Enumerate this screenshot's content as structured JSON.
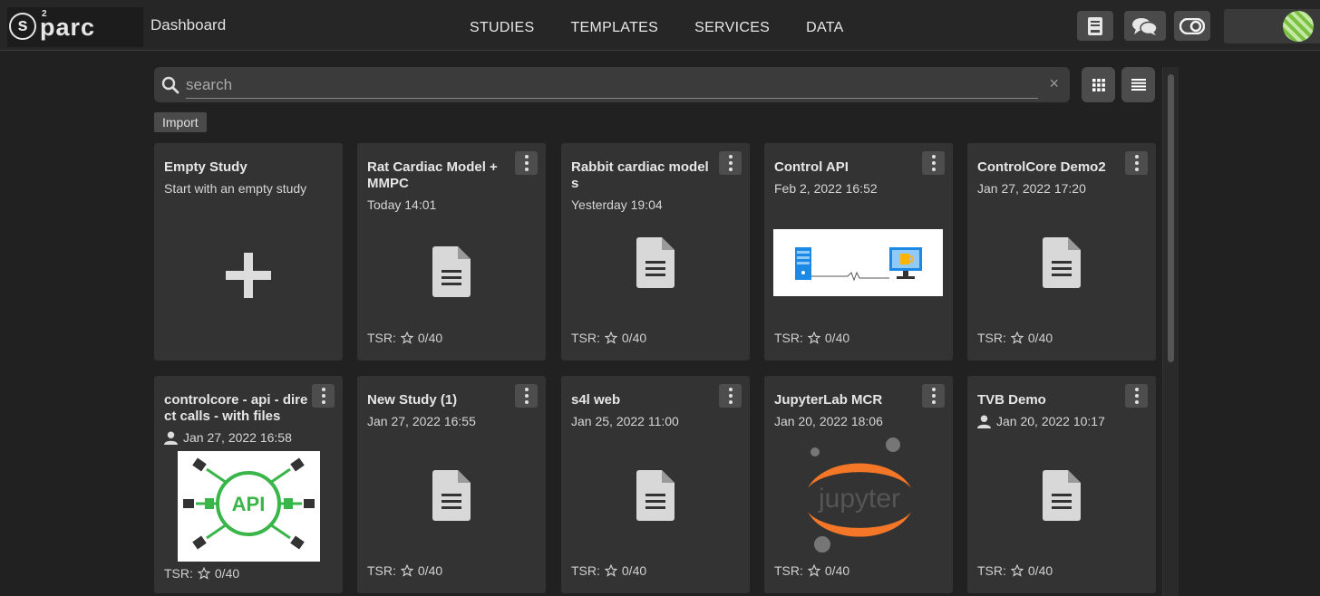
{
  "app": {
    "logo_text": "parc",
    "logo_sup": "2",
    "logo_letter": "s",
    "page_title": "Dashboard"
  },
  "nav": {
    "items": [
      {
        "label": "STUDIES"
      },
      {
        "label": "TEMPLATES"
      },
      {
        "label": "SERVICES"
      },
      {
        "label": "DATA"
      }
    ]
  },
  "toolbar": {
    "icons": [
      "manual-icon",
      "chat-icon",
      "theme-toggle-icon"
    ],
    "avatar": "user-avatar"
  },
  "search": {
    "placeholder": "search",
    "value": "",
    "clear": "×"
  },
  "view_modes": [
    "grid-view-icon",
    "list-view-icon"
  ],
  "import_label": "Import",
  "colors": {
    "background": "#212121",
    "card": "#333333",
    "accent_orange": "#f37726",
    "api_green": "#3ab54a"
  },
  "cards": [
    {
      "title": "Empty Study",
      "subtitle": "Start with an empty study",
      "type": "new"
    },
    {
      "title": "Rat Cardiac Model + MMPC",
      "date": "Today 14:01",
      "tsr": "TSR:",
      "tsr_value": "0/40",
      "thumb": "document-icon"
    },
    {
      "title": "Rabbit cardiac models",
      "date": "Yesterday 19:04",
      "tsr": "TSR:",
      "tsr_value": "0/40",
      "thumb": "document-icon"
    },
    {
      "title": "Control API",
      "date": "Feb 2, 2022 16:52",
      "tsr": "TSR:",
      "tsr_value": "0/40",
      "thumb": "server-to-monitor-image"
    },
    {
      "title": "ControlCore Demo2",
      "date": "Jan 27, 2022 17:20",
      "tsr": "TSR:",
      "tsr_value": "0/40",
      "thumb": "document-icon"
    },
    {
      "title": "controlcore - api - direct calls - with files",
      "date": "Jan 27, 2022 16:58",
      "shared": true,
      "tsr": "TSR:",
      "tsr_value": "0/40",
      "thumb": "api-image",
      "thumb_text": "API"
    },
    {
      "title": "New Study (1)",
      "date": "Jan 27, 2022 16:55",
      "tsr": "TSR:",
      "tsr_value": "0/40",
      "thumb": "document-icon"
    },
    {
      "title": "s4l web",
      "date": "Jan 25, 2022 11:00",
      "tsr": "TSR:",
      "tsr_value": "0/40",
      "thumb": "document-icon"
    },
    {
      "title": "JupyterLab MCR",
      "date": "Jan 20, 2022 18:06",
      "tsr": "TSR:",
      "tsr_value": "0/40",
      "thumb": "jupyter-logo",
      "thumb_text": "jupyter"
    },
    {
      "title": "TVB Demo",
      "date": "Jan 20, 2022 10:17",
      "shared": true,
      "tsr": "TSR:",
      "tsr_value": "0/40",
      "thumb": "document-icon"
    }
  ]
}
